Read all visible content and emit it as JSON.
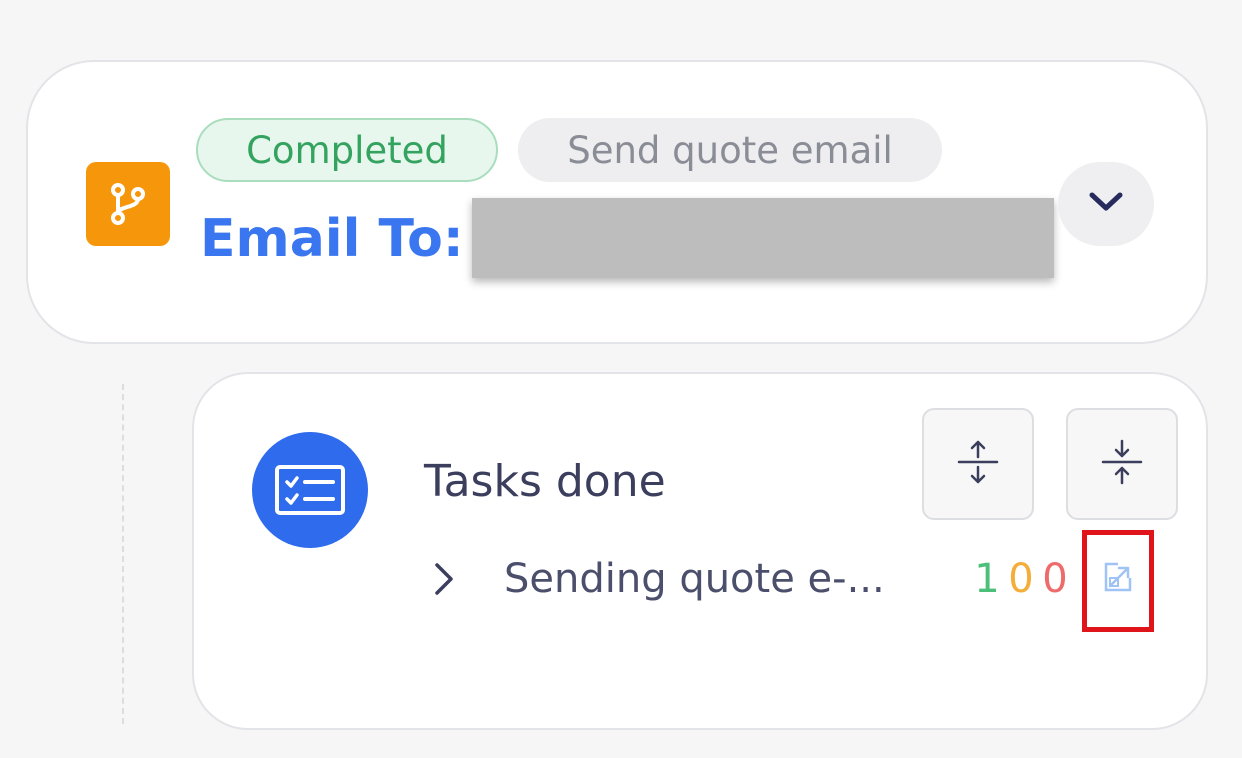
{
  "header_card": {
    "status_badge": "Completed",
    "step_badge": "Send quote email",
    "email_label": "Email To:",
    "icons": {
      "step_type": "branch-icon",
      "expand": "chevron-down-icon"
    },
    "colors": {
      "accent": "#3a76f0",
      "step_tile": "#f6960a",
      "completed_text": "#34a35f"
    }
  },
  "tasks_card": {
    "title": "Tasks done",
    "icons": {
      "main": "checklist-icon",
      "expand_all": "expand-vertical-icon",
      "collapse_all": "collapse-vertical-icon",
      "row_toggle": "chevron-right-icon",
      "open": "open-external-icon"
    },
    "rows": [
      {
        "name": "Sending quote e-...",
        "counts": {
          "success": "1",
          "warning": "0",
          "error": "0"
        }
      }
    ],
    "colors": {
      "success": "#4cbf7a",
      "warning": "#f5ad3a",
      "error": "#ef6b6b",
      "icon_bg": "#2f6bed"
    }
  }
}
